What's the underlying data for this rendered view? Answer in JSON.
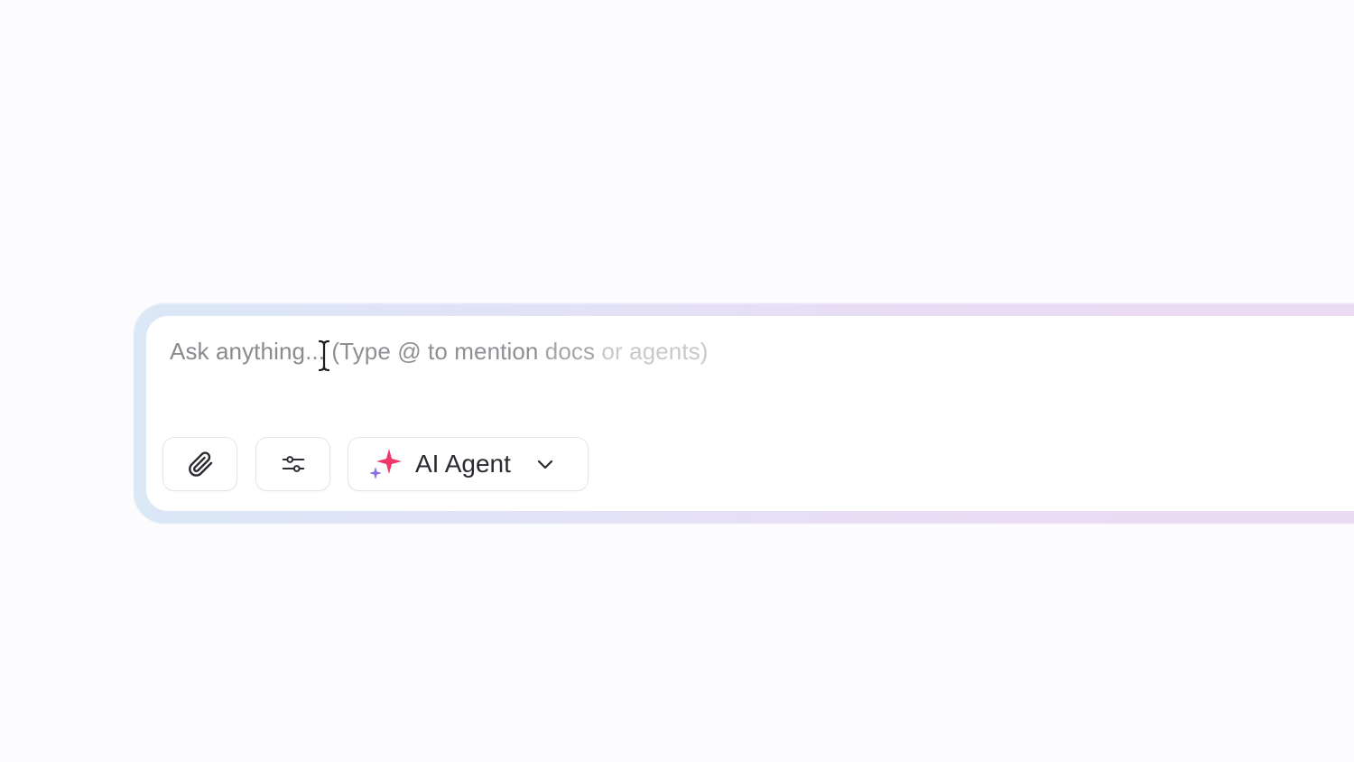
{
  "composer": {
    "placeholder_parts": [
      "Ask anything",
      "... (Type @ to mention",
      " docs",
      " or agents)"
    ],
    "attach_icon": "paperclip-icon",
    "settings_icon": "sliders-icon",
    "agent_selector": {
      "label": "AI Agent",
      "icon": "sparkle-icon",
      "chevron_icon": "chevron-down-icon"
    }
  },
  "colors": {
    "sparkle_primary": "#f0386b",
    "sparkle_secondary": "#8b6fe0",
    "frame_left": "#dbe8f6",
    "frame_right": "#eadbf3"
  }
}
